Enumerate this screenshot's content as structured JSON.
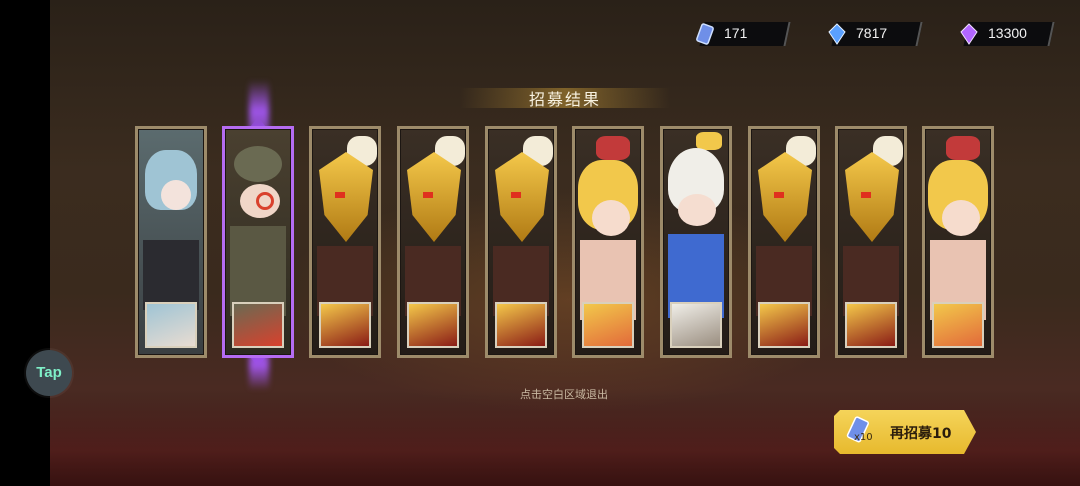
{
  "currencies": [
    {
      "icon": "ticket-icon",
      "value": "171"
    },
    {
      "icon": "blue-crystal-icon",
      "value": "7817"
    },
    {
      "icon": "purple-crystal-icon",
      "value": "13300"
    }
  ],
  "title": "招募结果",
  "cards": [
    {
      "character": "maid-girl"
    },
    {
      "character": "steampunk-engineer",
      "selected": true
    },
    {
      "character": "golden-fox-mask"
    },
    {
      "character": "golden-fox-mask"
    },
    {
      "character": "golden-fox-mask"
    },
    {
      "character": "blonde-clown-girl"
    },
    {
      "character": "egg-helmet-kid"
    },
    {
      "character": "golden-fox-mask"
    },
    {
      "character": "golden-fox-mask"
    },
    {
      "character": "blonde-clown-girl"
    }
  ],
  "hint": "点击空白区域退出",
  "recruit_button": {
    "count_badge": "x10",
    "label": "再招募10"
  },
  "tap_button": {
    "label": "Tap"
  },
  "colors": {
    "accent": "#eec043",
    "selected_glow": "#a24fff",
    "frame": "#9d8b6a"
  }
}
